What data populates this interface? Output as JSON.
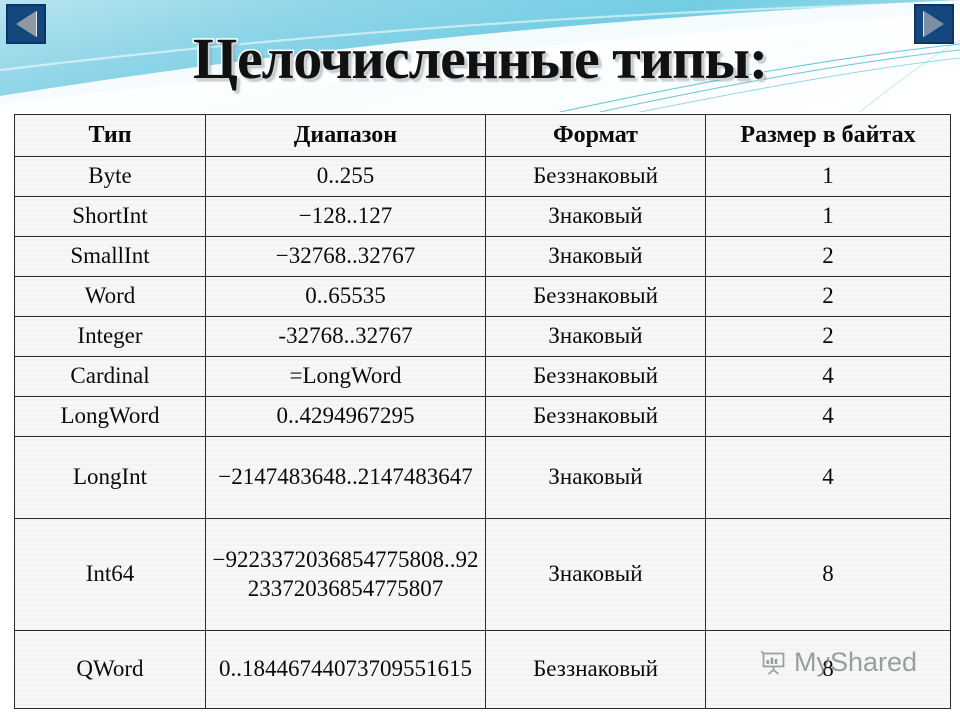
{
  "slide": {
    "title": "Целочисленные типы:"
  },
  "nav": {
    "prev_label": "◀",
    "next_label": "▶",
    "prev_name": "previous-slide",
    "next_name": "next-slide"
  },
  "table": {
    "headers": [
      "Тип",
      "Диапазон",
      "Формат",
      "Размер в байтах"
    ],
    "rows": [
      {
        "type": "Byte",
        "range": "0..255",
        "format": "Беззнаковый",
        "size": "1"
      },
      {
        "type": "ShortInt",
        "range": "−128..127",
        "format": "Знаковый",
        "size": "1"
      },
      {
        "type": "SmallInt",
        "range": "−32768..32767",
        "format": "Знаковый",
        "size": "2"
      },
      {
        "type": "Word",
        "range": "0..65535",
        "format": "Беззнаковый",
        "size": "2"
      },
      {
        "type": "Integer",
        "range": "-32768..32767",
        "format": "Знаковый",
        "size": "2"
      },
      {
        "type": "Cardinal",
        "range": "=LongWord",
        "format": "Беззнаковый",
        "size": "4"
      },
      {
        "type": "LongWord",
        "range": "0..4294967295",
        "format": "Беззнаковый",
        "size": "4"
      },
      {
        "type": "LongInt",
        "range": "−2147483648..2147483647",
        "format": "Знаковый",
        "size": "4"
      },
      {
        "type": "Int64",
        "range": "−9223372036854775808..9223372036854775807",
        "format": "Знаковый",
        "size": "8"
      },
      {
        "type": "QWord",
        "range": "0..18446744073709551615",
        "format": "Беззнаковый",
        "size": "8"
      }
    ]
  },
  "watermark": {
    "text": "MyShared",
    "icon": "presentation-board-icon"
  },
  "colors": {
    "header_band_start": "#b7e4ef",
    "header_band_end": "#72cde3",
    "nav_button": "#13477e",
    "table_border": "#2b2b2b",
    "table_background": "#f6f7f6",
    "title_text": "#111111",
    "watermark_text": "#5f6b66"
  }
}
